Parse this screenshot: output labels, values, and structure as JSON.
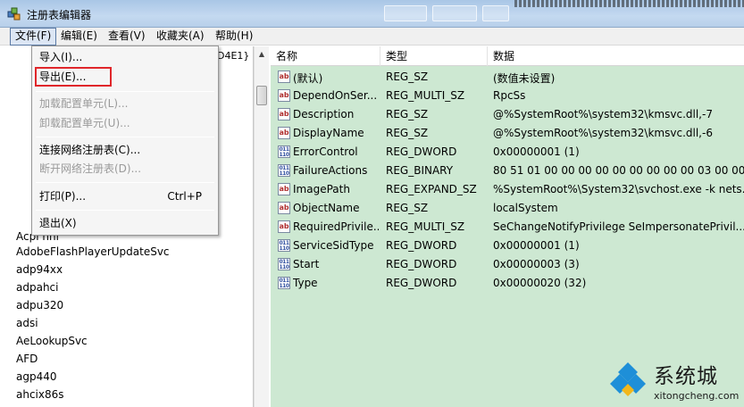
{
  "window": {
    "title": "注册表编辑器"
  },
  "menubar": {
    "items": [
      {
        "label": "文件(F)"
      },
      {
        "label": "编辑(E)"
      },
      {
        "label": "查看(V)"
      },
      {
        "label": "收藏夹(A)"
      },
      {
        "label": "帮助(H)"
      }
    ]
  },
  "file_menu": {
    "import": "导入(I)...",
    "export": "导出(E)...",
    "load_hive": "加载配置单元(L)...",
    "unload_hive": "卸载配置单元(U)...",
    "connect": "连接网络注册表(C)...",
    "disconnect": "断开网络注册表(D)...",
    "print": "打印(P)...",
    "print_shortcut": "Ctrl+P",
    "exit": "退出(X)"
  },
  "tree": {
    "top_id_fragment": "D4E1}",
    "partial_item": "Acpi nhi",
    "items": [
      "AdobeFlashPlayerUpdateSvc",
      "adp94xx",
      "adpahci",
      "adpu320",
      "adsi",
      "AeLookupSvc",
      "AFD",
      "agp440",
      "ahcix86s"
    ]
  },
  "list": {
    "headers": {
      "name": "名称",
      "type": "类型",
      "data": "数据"
    },
    "rows": [
      {
        "icon": "string-value-icon",
        "name": "(默认)",
        "type": "REG_SZ",
        "data": "(数值未设置)"
      },
      {
        "icon": "string-value-icon",
        "name": "DependOnSer...",
        "type": "REG_MULTI_SZ",
        "data": "RpcSs"
      },
      {
        "icon": "string-value-icon",
        "name": "Description",
        "type": "REG_SZ",
        "data": "@%SystemRoot%\\system32\\kmsvc.dll,-7"
      },
      {
        "icon": "string-value-icon",
        "name": "DisplayName",
        "type": "REG_SZ",
        "data": "@%SystemRoot%\\system32\\kmsvc.dll,-6"
      },
      {
        "icon": "binary-value-icon",
        "name": "ErrorControl",
        "type": "REG_DWORD",
        "data": "0x00000001 (1)"
      },
      {
        "icon": "binary-value-icon",
        "name": "FailureActions",
        "type": "REG_BINARY",
        "data": "80 51 01 00 00 00 00 00 00 00 00 00 03 00 00..."
      },
      {
        "icon": "string-value-icon",
        "name": "ImagePath",
        "type": "REG_EXPAND_SZ",
        "data": "%SystemRoot%\\System32\\svchost.exe -k nets..."
      },
      {
        "icon": "string-value-icon",
        "name": "ObjectName",
        "type": "REG_SZ",
        "data": "localSystem"
      },
      {
        "icon": "string-value-icon",
        "name": "RequiredPrivile...",
        "type": "REG_MULTI_SZ",
        "data": "SeChangeNotifyPrivilege SeImpersonatePrivil..."
      },
      {
        "icon": "binary-value-icon",
        "name": "ServiceSidType",
        "type": "REG_DWORD",
        "data": "0x00000001 (1)"
      },
      {
        "icon": "binary-value-icon",
        "name": "Start",
        "type": "REG_DWORD",
        "data": "0x00000003 (3)"
      },
      {
        "icon": "binary-value-icon",
        "name": "Type",
        "type": "REG_DWORD",
        "data": "0x00000020 (32)"
      }
    ]
  },
  "watermark": {
    "brand": "系统城",
    "url": "xitongcheng.com"
  },
  "colors": {
    "list_bg": "#cde8d2",
    "highlight_box": "#e0262a",
    "accent": "#1e8fd8"
  }
}
